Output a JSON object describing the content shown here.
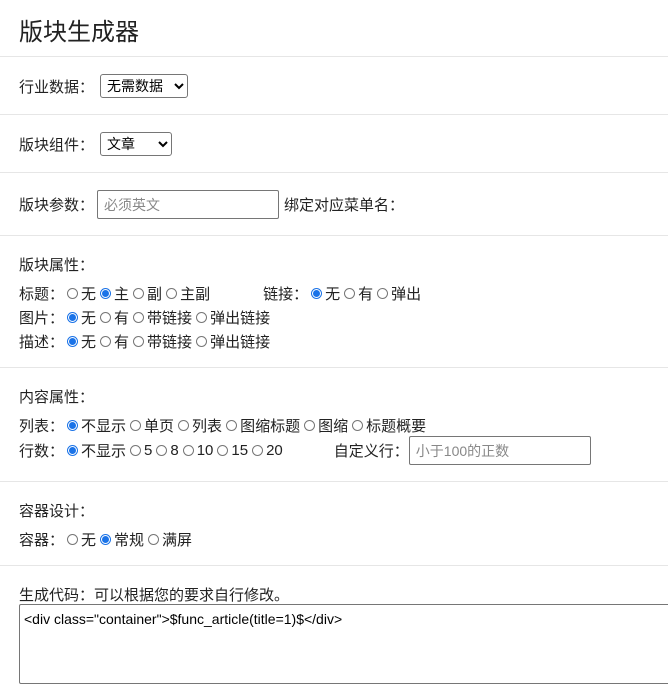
{
  "page": {
    "title": "版块生成器"
  },
  "industry": {
    "label": "行业数据：",
    "selected": "无需数据"
  },
  "component": {
    "label": "版块组件：",
    "selected": "文章"
  },
  "params": {
    "label": "版块参数：",
    "placeholder": "必须英文",
    "bind_label": "绑定对应菜单名："
  },
  "block_attrs": {
    "heading": "版块属性：",
    "title": {
      "label": "标题：",
      "options": [
        "无",
        "主",
        "副",
        "主副"
      ],
      "selected": "主"
    },
    "link": {
      "label": "链接：",
      "options": [
        "无",
        "有",
        "弹出"
      ],
      "selected": "无"
    },
    "image": {
      "label": "图片：",
      "options": [
        "无",
        "有",
        "带链接",
        "弹出链接"
      ],
      "selected": "无"
    },
    "desc": {
      "label": "描述：",
      "options": [
        "无",
        "有",
        "带链接",
        "弹出链接"
      ],
      "selected": "无"
    }
  },
  "content_attrs": {
    "heading": "内容属性：",
    "list": {
      "label": "列表：",
      "options": [
        "不显示",
        "单页",
        "列表",
        "图缩标题",
        "图缩",
        "标题概要"
      ],
      "selected": "不显示"
    },
    "rows": {
      "label": "行数：",
      "options": [
        "不显示",
        "5",
        "8",
        "10",
        "15",
        "20"
      ],
      "selected": "不显示"
    },
    "custom_rows": {
      "label": "自定义行：",
      "placeholder": "小于100的正数"
    }
  },
  "container": {
    "heading": "容器设计：",
    "field": {
      "label": "容器：",
      "options": [
        "无",
        "常规",
        "满屏"
      ],
      "selected": "常规"
    }
  },
  "output": {
    "label": "生成代码：可以根据您的要求自行修改。",
    "code": "<div class=\"container\">$func_article(title=1)$</div>"
  },
  "colors": {
    "accent": "#1a73e8",
    "divider": "#e6e6e6"
  }
}
